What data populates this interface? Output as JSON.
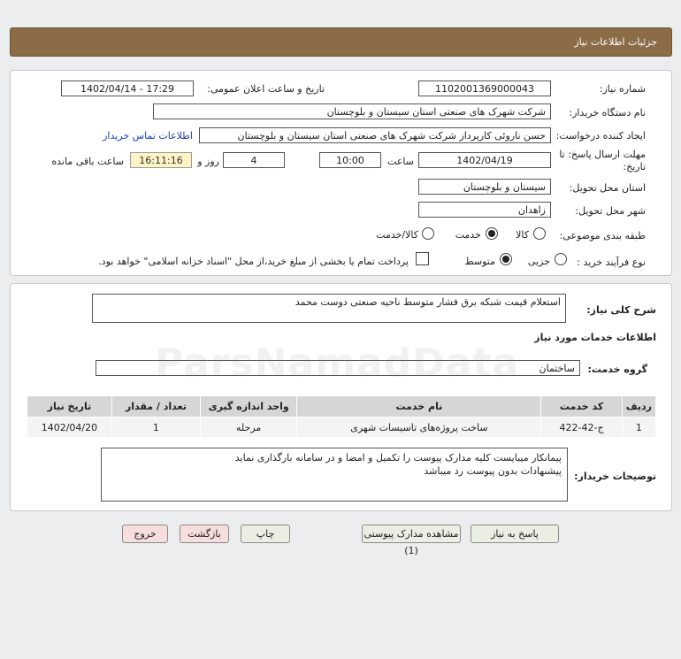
{
  "header": {
    "title": "جزئیات اطلاعات نیاز"
  },
  "info": {
    "need_number_label": "شماره نیاز:",
    "need_number": "1102001369000043",
    "announce_label": "تاریخ و ساعت اعلان عمومی:",
    "announce_value": "1402/04/14 - 17:29",
    "buyer_label": "نام دستگاه خریدار:",
    "buyer_value": "شرکت شهرک های صنعتی استان سیستان و بلوچستان",
    "creator_label": "ایجاد کننده درخواست:",
    "creator_value": "حسن ناروئی کارپرداز شرکت شهرک های صنعتی استان سیستان و بلوچستان",
    "contact_link": "اطلاعات تماس خریدار",
    "deadline_label_1": "مهلت ارسال پاسخ: تا",
    "deadline_label_2": "تاریخ:",
    "deadline_date": "1402/04/19",
    "time_label": "ساعت",
    "deadline_time": "10:00",
    "days_value": "4",
    "days_label": "روز و",
    "remaining_time": "16:11:16",
    "remaining_label": "ساعت باقی مانده",
    "province_label": "استان محل تحویل:",
    "province_value": "سیستان و بلوچستان",
    "city_label": "شهر محل تحویل:",
    "city_value": "زاهدان",
    "category_label": "طبقه بندی موضوعی:",
    "category_options": [
      "کالا",
      "خدمت",
      "کالا/خدمت"
    ],
    "process_label": "نوع فرآیند خرید :",
    "process_options": [
      "جزیی",
      "متوسط"
    ],
    "payment_note": "پرداخت تمام یا بخشی از مبلغ خرید،از محل \"اسناد خزانه اسلامی\" خواهد بود."
  },
  "summary": {
    "label": "شرح کلی نیاز:",
    "value": "استعلام قیمت شبکه برق فشار متوسط ناحیه صنعتی دوست محمد"
  },
  "services": {
    "title": "اطلاعات خدمات مورد نیاز",
    "group_label": "گروه خدمت:",
    "group_value": "ساختمان",
    "columns": [
      "ردیف",
      "کد خدمت",
      "نام خدمت",
      "واحد اندازه گیری",
      "تعداد / مقدار",
      "تاریخ نیاز"
    ],
    "rows": [
      [
        "1",
        "ج-42-422",
        "ساخت پروژه‌های تاسیسات شهری",
        "مرحله",
        "1",
        "1402/04/20"
      ]
    ]
  },
  "notes": {
    "label": "توضیحات خریدار:",
    "line1": "پیمانکار میبایست کلیه مدارک پیوست را تکمیل و امضا و در سامانه بارگذاری نماید",
    "line2": "پیشنهادات بدون پیوست رد میباشد"
  },
  "buttons": {
    "reply": "پاسخ به نیاز",
    "view_docs": "مشاهده مدارک پیوستی (1)",
    "print": "چاپ",
    "back": "بازگشت",
    "exit": "خروج"
  },
  "watermark": "ParsNamadData",
  "colors": {
    "header_bg": "#8b6c47",
    "link": "#1d3db8",
    "remaining_bg": "#fbf4c4"
  }
}
